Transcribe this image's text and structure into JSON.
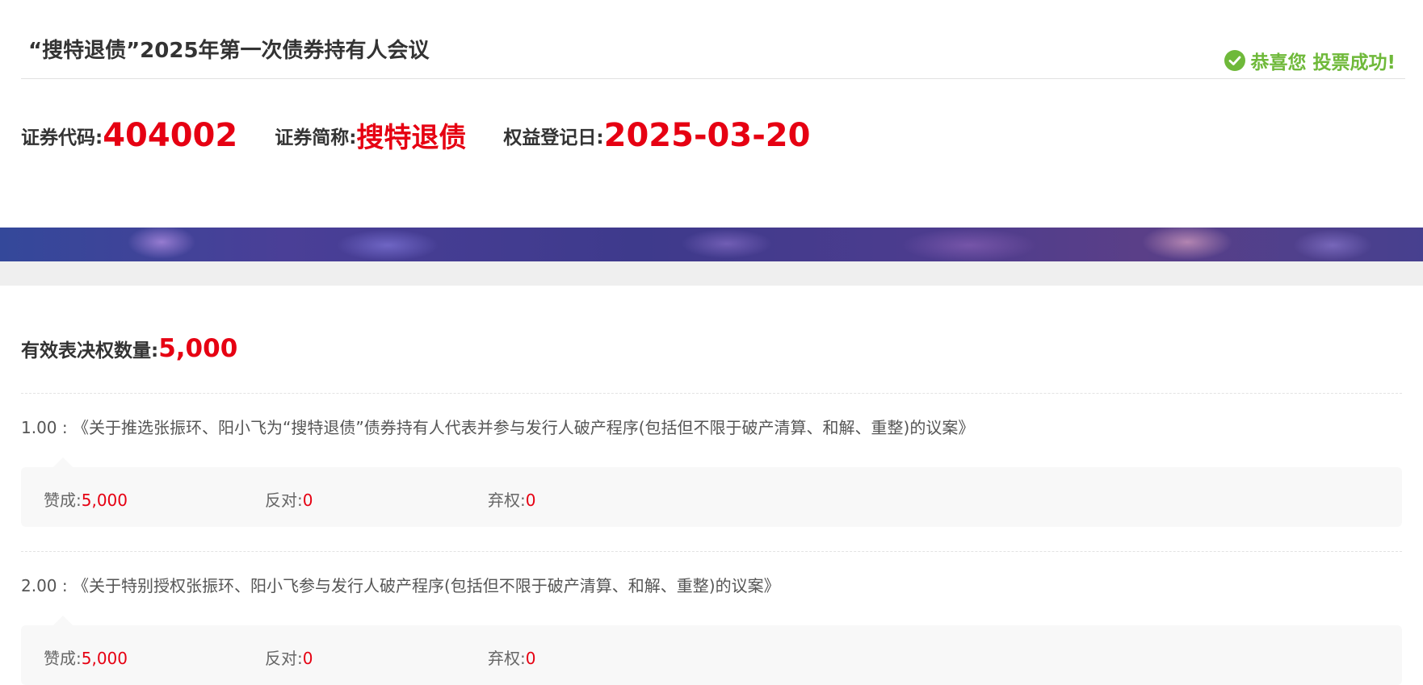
{
  "header": {
    "meeting_title": "“搜特退债”2025年第一次债券持有人会议",
    "success_message": "恭喜您 投票成功!",
    "success_icon": "check-circle-icon",
    "success_color": "#6fb93a"
  },
  "info": {
    "code_label": "证券代码:",
    "code_value": "404002",
    "short_name_label": "证券简称:",
    "short_name_value": "搜特退债",
    "record_date_label": "权益登记日:",
    "record_date_value": "2025-03-20"
  },
  "votes": {
    "label": "有效表决权数量:",
    "value": "5,000"
  },
  "proposals": [
    {
      "number": "1.00 :",
      "title": "《关于推选张振环、阳小飞为“搜特退债”债券持有人代表并参与发行人破产程序(包括但不限于破产清算、和解、重整)的议案》",
      "for_label": "赞成:",
      "for_value": "5,000",
      "against_label": "反对:",
      "against_value": "0",
      "abstain_label": "弃权:",
      "abstain_value": "0"
    },
    {
      "number": "2.00 :",
      "title": "《关于特别授权张振环、阳小飞参与发行人破产程序(包括但不限于破产清算、和解、重整)的议案》",
      "for_label": "赞成:",
      "for_value": "5,000",
      "against_label": "反对:",
      "against_value": "0",
      "abstain_label": "弃权:",
      "abstain_value": "0"
    }
  ],
  "colors": {
    "accent_red": "#e60012",
    "text_dark": "#333333",
    "banner": "#3e3a8c"
  }
}
